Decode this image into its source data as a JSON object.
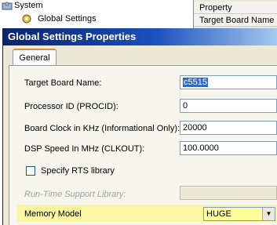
{
  "tree": {
    "system_label": "System",
    "global_settings_label": "Global Settings"
  },
  "property_grid": {
    "header": "Property",
    "row1": "Target Board Name"
  },
  "dialog": {
    "title": "Global Settings Properties",
    "tab": "General",
    "target_board_label": "Target Board Name:",
    "target_board_value": "c5515",
    "processor_id_label": "Processor ID (PROCID):",
    "processor_id_value": "0",
    "board_clock_label": "Board Clock in KHz (Informational Only):",
    "board_clock_value": "20000",
    "dsp_speed_label": "DSP Speed In MHz (CLKOUT):",
    "dsp_speed_value": "100.0000",
    "specify_rts_label": "Specify RTS library",
    "specify_rts_checked": false,
    "rts_library_label": "Run-Time Support Library:",
    "rts_library_value": "",
    "memory_model_label": "Memory Model",
    "memory_model_value": "HUGE"
  },
  "colors": {
    "title_gradient_start": "#0a246a",
    "selection": "#316ac5",
    "memory_model_highlight": "#fbf6a3"
  }
}
